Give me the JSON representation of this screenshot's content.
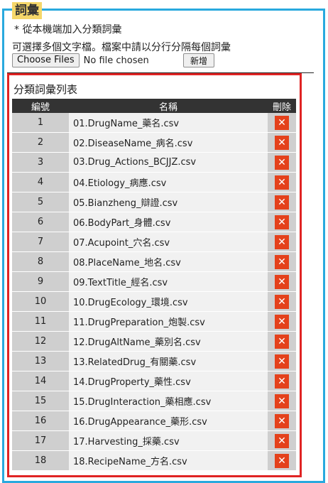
{
  "panel": {
    "title": "詞彙",
    "subtitle": "* 從本機端加入分類詞彙",
    "hint": "可選擇多個文字檔。檔案中請以分行分隔每個詞彙",
    "choose_files_label": "Choose Files",
    "no_file_text": "No file chosen",
    "add_button_label": "新增"
  },
  "list": {
    "title": "分類詞彙列表",
    "columns": {
      "number": "編號",
      "name": "名稱",
      "delete": "刪除"
    },
    "delete_icon": "✕",
    "rows": [
      {
        "number": "1",
        "name": "01.DrugName_藥名.csv"
      },
      {
        "number": "2",
        "name": "02.DiseaseName_病名.csv"
      },
      {
        "number": "3",
        "name": "03.Drug_Actions_BCJJZ.csv"
      },
      {
        "number": "4",
        "name": "04.Etiology_病應.csv"
      },
      {
        "number": "5",
        "name": "05.Bianzheng_辯證.csv"
      },
      {
        "number": "6",
        "name": "06.BodyPart_身體.csv"
      },
      {
        "number": "7",
        "name": "07.Acupoint_穴名.csv"
      },
      {
        "number": "8",
        "name": "08.PlaceName_地名.csv"
      },
      {
        "number": "9",
        "name": "09.TextTitle_經名.csv"
      },
      {
        "number": "10",
        "name": "10.DrugEcology_環境.csv"
      },
      {
        "number": "11",
        "name": "11.DrugPreparation_炮製.csv"
      },
      {
        "number": "12",
        "name": "12.DrugAltName_藥別名.csv"
      },
      {
        "number": "13",
        "name": "13.RelatedDrug_有關藥.csv"
      },
      {
        "number": "14",
        "name": "14.DrugProperty_藥性.csv"
      },
      {
        "number": "15",
        "name": "15.DrugInteraction_藥相應.csv"
      },
      {
        "number": "16",
        "name": "16.DrugAppearance_藥形.csv"
      },
      {
        "number": "17",
        "name": "17.Harvesting_採藥.csv"
      },
      {
        "number": "18",
        "name": "18.RecipeName_方名.csv"
      }
    ]
  },
  "colors": {
    "outer_border": "#29a9de",
    "title_tab": "#f5d76a",
    "list_border": "#e02424",
    "header_bg": "#333333",
    "delete_button": "#e4411b"
  }
}
